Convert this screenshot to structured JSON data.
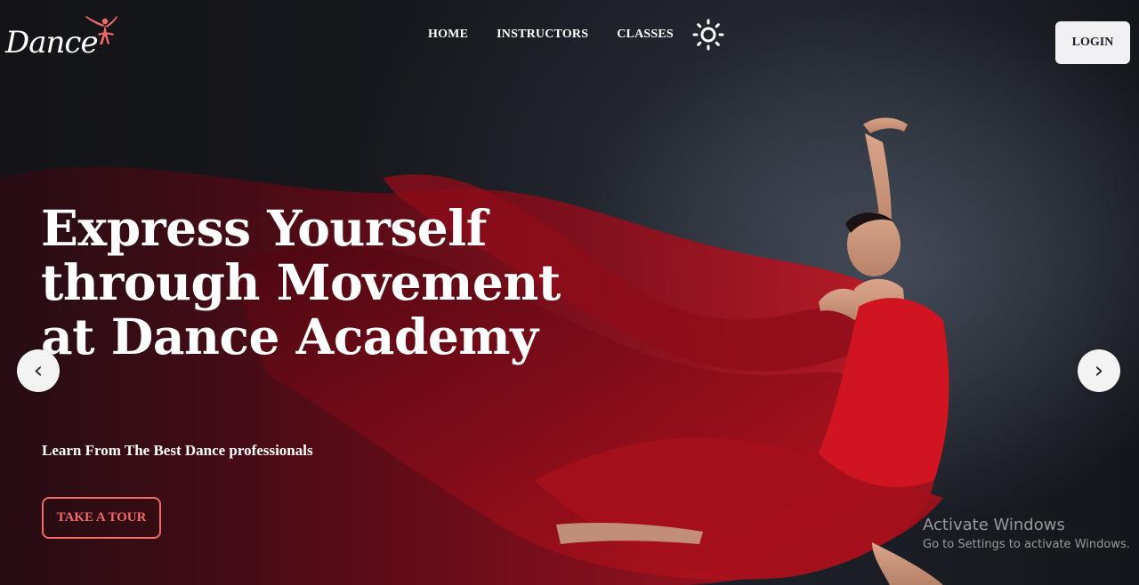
{
  "brand": {
    "logo_text": "Dance",
    "accent": "#f06a6a"
  },
  "nav": {
    "links": [
      "HOME",
      "INSTRUCTORS",
      "CLASSES"
    ],
    "theme_icon": "sun-icon",
    "login_label": "LOGIN"
  },
  "hero": {
    "title": "Express Yourself through Movement at Dance Academy",
    "subtitle": "Learn From The Best Dance professionals",
    "cta_label": "TAKE A TOUR",
    "prev_icon": "‹",
    "next_icon": "›"
  },
  "watermark": {
    "title": "Activate Windows",
    "subtitle": "Go to Settings to activate Windows."
  }
}
